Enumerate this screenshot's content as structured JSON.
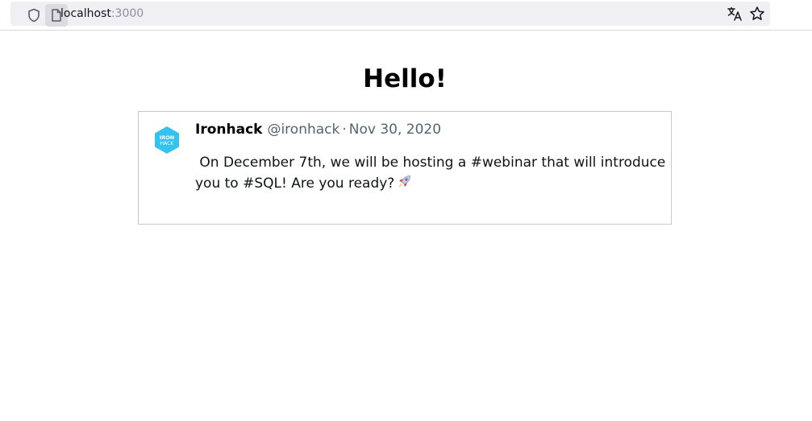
{
  "browser": {
    "url_host": "localhost",
    "url_port": ":3000",
    "icons": [
      "shield-icon",
      "page-icon",
      "translate-icon",
      "bookmark-star-icon"
    ]
  },
  "page": {
    "heading": "Hello!"
  },
  "tweet": {
    "avatar_text_line1": "IRON",
    "avatar_text_line2": "HACK",
    "name": "Ironhack",
    "handle": "@ironhack",
    "separator": "·",
    "date": "Nov 30, 2020",
    "text": " On December 7th, we will be hosting a #webinar that will introduce you to #SQL! Are you ready?",
    "emoji_icon": "rocket-icon",
    "colors": {
      "avatar_bg": "#32c3f0",
      "secondary_text": "#536471",
      "border": "#c9c9c9"
    }
  }
}
